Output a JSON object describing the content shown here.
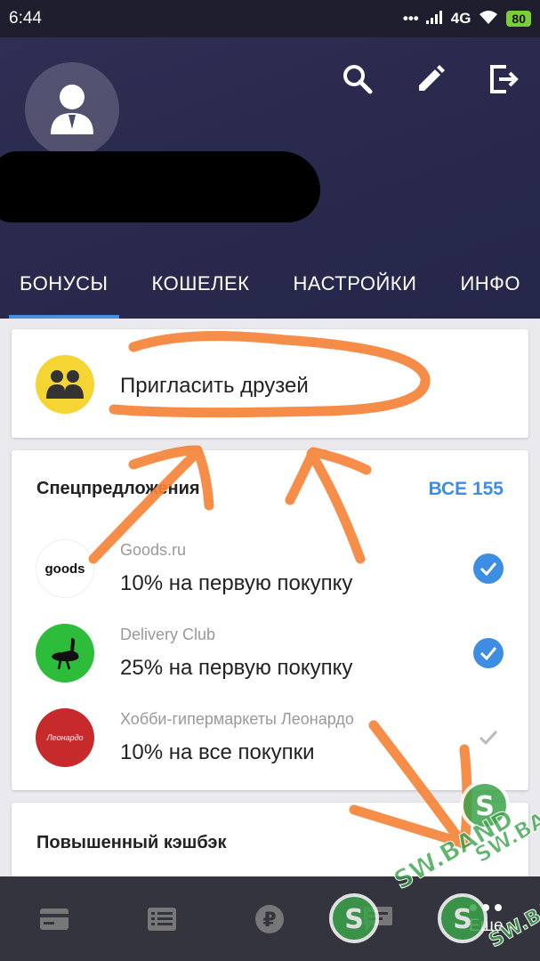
{
  "status_bar": {
    "time": "6:44",
    "network": "4G",
    "battery": "80"
  },
  "tabs": [
    {
      "label": "БОНУСЫ",
      "active": true
    },
    {
      "label": "КОШЕЛЕК",
      "active": false
    },
    {
      "label": "НАСТРОЙКИ",
      "active": false
    },
    {
      "label": "ИНФО",
      "active": false
    }
  ],
  "invite": {
    "label": "Пригласить друзей"
  },
  "offers": {
    "title": "Спецпредложения",
    "all_label": "ВСЕ 155",
    "items": [
      {
        "brand": "Goods.ru",
        "desc": "10% на первую покупку",
        "logo_text": "goods",
        "checked": true
      },
      {
        "brand": "Delivery Club",
        "desc": "25% на первую покупку",
        "logo_text": "",
        "checked": true
      },
      {
        "brand": "Хобби-гипермаркеты Леонардо",
        "desc": "10% на все покупки",
        "logo_text": "Леонардо",
        "checked": false
      }
    ]
  },
  "cashback": {
    "title": "Повышенный кэшбэк"
  },
  "bottom_nav": {
    "more_label": "Еще"
  },
  "watermark": {
    "text": "SW.BAND"
  },
  "colors": {
    "header": "#2a2a4e",
    "accent": "#3d8ee3",
    "annotation": "#f5843a",
    "nav": "#34343f"
  }
}
